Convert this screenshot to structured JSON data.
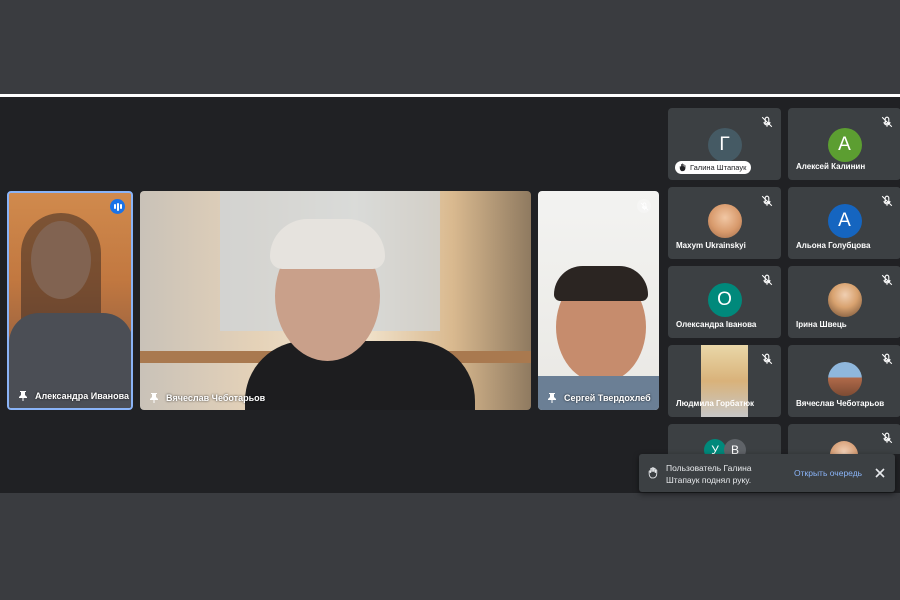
{
  "main_tiles": [
    {
      "name": "Александра Иванова"
    },
    {
      "name": "Вячеслав Чеботарьов"
    },
    {
      "name": "Сергей Твердохлеб"
    }
  ],
  "grid_tiles": [
    {
      "initial": "Г",
      "name": "Галина Штапаук",
      "color": "#455a64"
    },
    {
      "initial": "А",
      "name": "Алексей Калинин",
      "color": "#5c9e31"
    },
    {
      "initial": "",
      "name": "Maxym Ukrainskyi",
      "color": ""
    },
    {
      "initial": "А",
      "name": "Альона Голубцова",
      "color": "#1565c0"
    },
    {
      "initial": "О",
      "name": "Олександра Іванова",
      "color": "#00897b"
    },
    {
      "initial": "",
      "name": "Ірина Швець",
      "color": ""
    },
    {
      "initial": "",
      "name": "Людмила Горбатюк",
      "color": ""
    },
    {
      "initial": "",
      "name": "Вячеслав Чеботарьов",
      "color": ""
    },
    {
      "initial": "У",
      "initial2": "В",
      "name": "",
      "color": "#00897b",
      "color2": "#5f6368"
    },
    {
      "initial": "",
      "name": "",
      "color": ""
    }
  ],
  "toast": {
    "message": "Пользователь Галина Штапаук поднял руку.",
    "action": "Открыть очередь"
  },
  "colors": {
    "accent": "#8ab4f8",
    "speaking": "#1a73e8"
  }
}
